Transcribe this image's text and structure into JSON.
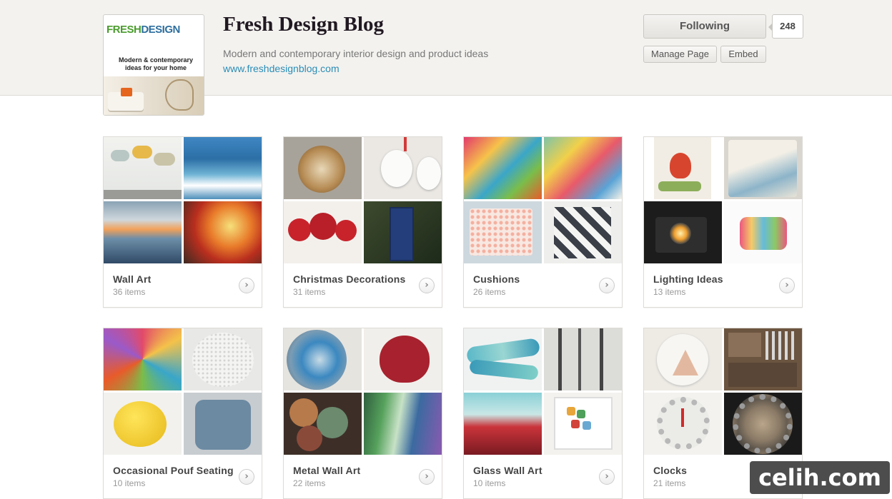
{
  "profile": {
    "title": "Fresh Design Blog",
    "description": "Modern and contemporary interior design and product ideas",
    "url": "www.freshdesignblog.com",
    "avatar_logo_main": "FRESH",
    "avatar_logo_accent": "DESIGN",
    "avatar_tagline": "Modern & contemporary ideas for your home"
  },
  "actions": {
    "following_label": "Following",
    "follower_count": "248",
    "manage_label": "Manage Page",
    "embed_label": "Embed"
  },
  "boards": [
    {
      "name": "Wall Art",
      "count": "36 items"
    },
    {
      "name": "Christmas Decorations",
      "count": "31 items"
    },
    {
      "name": "Cushions",
      "count": "26 items"
    },
    {
      "name": "Lighting Ideas",
      "count": "13 items"
    },
    {
      "name": "Occasional Pouf Seating",
      "count": "10 items"
    },
    {
      "name": "Metal Wall Art",
      "count": "22 items"
    },
    {
      "name": "Glass Wall Art",
      "count": "10 items"
    },
    {
      "name": "Clocks",
      "count": "21 items"
    }
  ],
  "watermark": "celih.com"
}
